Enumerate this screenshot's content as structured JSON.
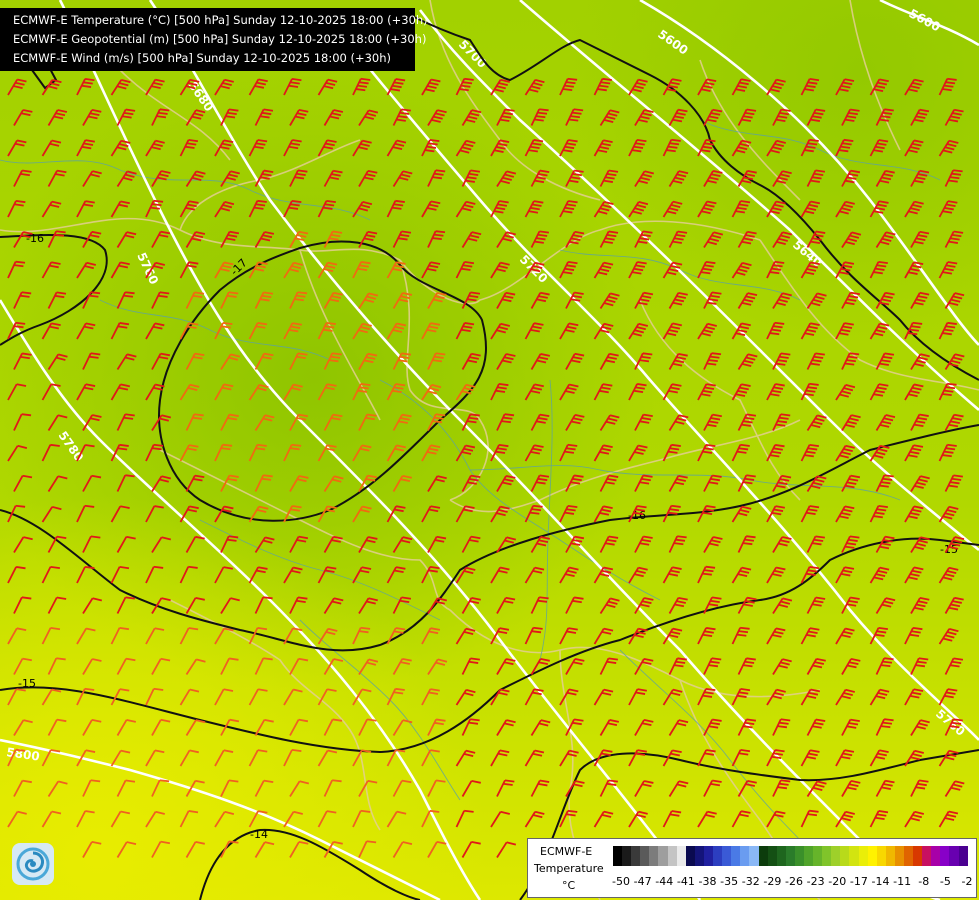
{
  "titles": [
    "ECMWF-E Temperature (°C) [500 hPa] Sunday 12-10-2025 18:00 (+30h)",
    "ECMWF-E Geopotential (m) [500 hPa] Sunday 12-10-2025 18:00 (+30h)",
    "ECMWF-E Wind (m/s) [500 hPa] Sunday 12-10-2025 18:00 (+30h)"
  ],
  "map": {
    "geopotential_labels": [
      "5600",
      "5600",
      "5640",
      "5680",
      "5700",
      "5720",
      "5760",
      "5760",
      "5780",
      "5800"
    ],
    "temperature_labels": [
      "-16",
      "-17",
      "-16",
      "-15",
      "-15",
      "-14"
    ]
  },
  "legend": {
    "source": "ECMWF-E",
    "variable": "Temperature",
    "unit": "°C",
    "colors": [
      "#000000",
      "#1a1a1a",
      "#3a3a3a",
      "#5a5a5a",
      "#7c7c7c",
      "#9e9e9e",
      "#c4c4c4",
      "#eaeaea",
      "#0a0a50",
      "#14147a",
      "#2020a0",
      "#2c3ec0",
      "#3a5ad6",
      "#4a7ae6",
      "#6a9cf0",
      "#8ab8f6",
      "#0c3c0c",
      "#145014",
      "#1e661e",
      "#2a7c2a",
      "#3a902a",
      "#50a42a",
      "#66b42a",
      "#80c42a",
      "#9ed02a",
      "#b8da1a",
      "#d2e410",
      "#eaee08",
      "#fff200",
      "#f8d800",
      "#f0b800",
      "#e89000",
      "#e06400",
      "#d83800",
      "#c81060",
      "#a800a8",
      "#8800c8",
      "#6800b0",
      "#4a0090"
    ],
    "ticks": [
      "-50",
      "-47",
      "-44",
      "-41",
      "-38",
      "-35",
      "-32",
      "-29",
      "-26",
      "-23",
      "-20",
      "-17",
      "-14",
      "-11",
      "-8",
      "-5",
      "-2"
    ]
  }
}
